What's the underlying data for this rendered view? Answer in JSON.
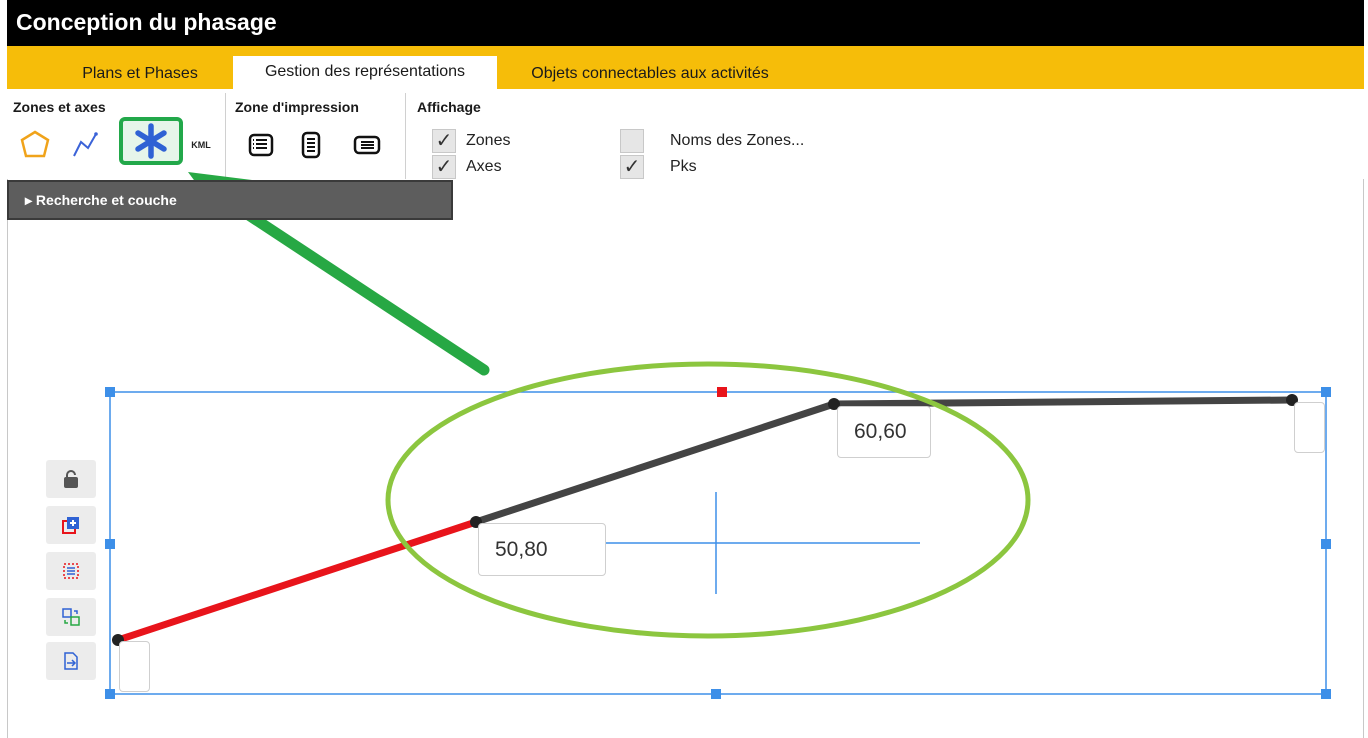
{
  "window": {
    "title": "Conception du phasage"
  },
  "tabs": [
    {
      "label": "Plans et Phases",
      "active": false
    },
    {
      "label": "Gestion des représentations",
      "active": true
    },
    {
      "label": "Objets connectables aux activités",
      "active": false
    }
  ],
  "ribbon": {
    "zones_axes": {
      "title": "Zones et axes",
      "buttons": [
        {
          "icon": "polygon-icon"
        },
        {
          "icon": "polyline-icon"
        },
        {
          "icon": "asterisk-icon",
          "selected": true
        },
        {
          "icon": "kml-icon",
          "label": "KML"
        }
      ]
    },
    "zone_impression": {
      "title": "Zone d'impression",
      "buttons": [
        {
          "icon": "print-landscape-list-icon"
        },
        {
          "icon": "print-portrait-list-icon"
        },
        {
          "icon": "print-wide-list-icon"
        }
      ]
    },
    "affichage": {
      "title": "Affichage",
      "options": [
        {
          "label": "Zones",
          "checked": true
        },
        {
          "label": "Axes",
          "checked": true
        },
        {
          "label": "Noms des Zones...",
          "checked": false
        },
        {
          "label": "Pks",
          "checked": true
        }
      ]
    }
  },
  "search_panel": {
    "label": "▸ Recherche et couche"
  },
  "left_tools": [
    {
      "icon": "lock-icon"
    },
    {
      "icon": "add-layer-icon"
    },
    {
      "icon": "list-select-icon"
    },
    {
      "icon": "swap-icon"
    },
    {
      "icon": "export-icon"
    }
  ],
  "canvas": {
    "pk_labels": [
      "50,80",
      "60,60"
    ],
    "colors": {
      "selection": "#3d8fe8",
      "axis_active": "#e8141b",
      "axis_inactive": "#444444",
      "ellipse": "#8cc63f",
      "arrow": "#27a844",
      "handle_center": "#e8141b"
    }
  }
}
